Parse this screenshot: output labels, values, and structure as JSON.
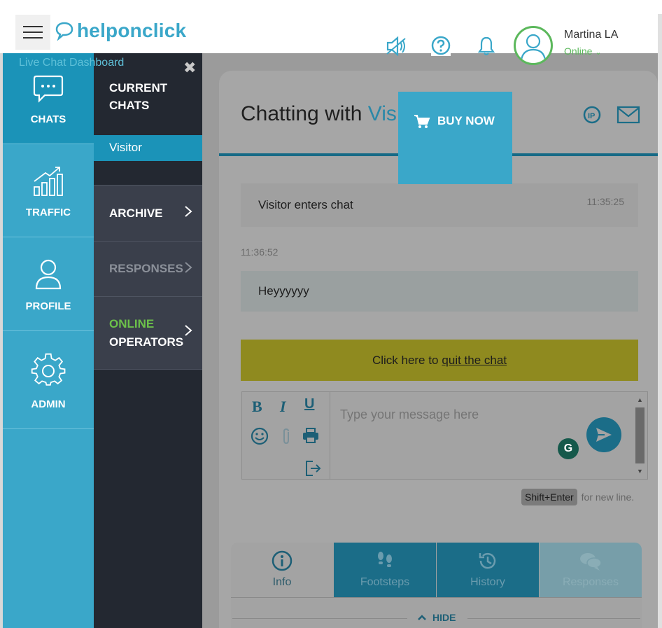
{
  "header": {
    "logo_text": "helponclick",
    "dashboard_label": "Live Chat Dashboard",
    "user": {
      "name": "Martina LA",
      "status": "Online"
    },
    "icons": [
      "sound-muted-icon",
      "help-icon",
      "bell-icon",
      "user-avatar-icon"
    ]
  },
  "nav_primary": {
    "items": [
      {
        "label": "CHATS",
        "icon": "chat-bubble-icon",
        "active": true
      },
      {
        "label": "TRAFFIC",
        "icon": "bar-chart-icon",
        "active": false
      },
      {
        "label": "PROFILE",
        "icon": "person-icon",
        "active": false
      },
      {
        "label": "ADMIN",
        "icon": "gear-icon",
        "active": false
      }
    ]
  },
  "nav_secondary": {
    "current_line1": "CURRENT",
    "current_line2": "CHATS",
    "active_chat": "Visitor",
    "archive": "ARCHIVE",
    "responses": "RESPONSES",
    "online_line1": "ONLINE",
    "online_line2": "OPERATORS"
  },
  "chat": {
    "title_prefix": "Chatting with ",
    "title_name": "Vis",
    "buy_now": "BUY NOW",
    "messages": [
      {
        "text": "Visitor enters chat",
        "time": "11:35:25"
      },
      {
        "text": "Heyyyyyy",
        "time": "11:36:52"
      }
    ],
    "quit_prefix": "Click here to",
    "quit_link": "quit the chat",
    "input_placeholder": "Type your message here",
    "hint_key": "Shift+Enter",
    "hint_text": "for new line."
  },
  "tabs": [
    {
      "label": "Info",
      "icon": "info-icon"
    },
    {
      "label": "Footsteps",
      "icon": "footsteps-icon"
    },
    {
      "label": "History",
      "icon": "history-icon"
    },
    {
      "label": "Responses",
      "icon": "speech-bubbles-icon"
    }
  ],
  "hide_label": "HIDE",
  "colors": {
    "brand": "#3aa7c9",
    "brand_dark": "#1b93b8",
    "sidebar_dark": "#232831",
    "online_green": "#5cb85c",
    "overlay_gray": "#9b9b9b"
  }
}
